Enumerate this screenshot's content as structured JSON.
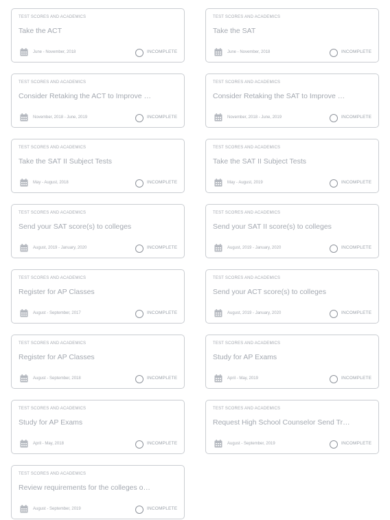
{
  "tasks": [
    {
      "category": "TEST SCORES AND ACADEMICS",
      "title": "Take the ACT",
      "date": "June - November, 2018",
      "status": "INCOMPLETE"
    },
    {
      "category": "TEST SCORES AND ACADEMICS",
      "title": "Take the SAT",
      "date": "June - November, 2018",
      "status": "INCOMPLETE"
    },
    {
      "category": "TEST SCORES AND ACADEMICS",
      "title": "Consider Retaking the ACT to Improve …",
      "date": "November, 2018 - June, 2019",
      "status": "INCOMPLETE"
    },
    {
      "category": "TEST SCORES AND ACADEMICS",
      "title": "Consider Retaking the SAT to Improve …",
      "date": "November, 2018 - June, 2019",
      "status": "INCOMPLETE"
    },
    {
      "category": "TEST SCORES AND ACADEMICS",
      "title": "Take the SAT II Subject Tests",
      "date": "May - August, 2018",
      "status": "INCOMPLETE"
    },
    {
      "category": "TEST SCORES AND ACADEMICS",
      "title": "Take the SAT II Subject Tests",
      "date": "May - August, 2019",
      "status": "INCOMPLETE"
    },
    {
      "category": "TEST SCORES AND ACADEMICS",
      "title": "Send your SAT score(s) to colleges",
      "date": "August, 2019 - January, 2020",
      "status": "INCOMPLETE"
    },
    {
      "category": "TEST SCORES AND ACADEMICS",
      "title": "Send your SAT II score(s) to colleges",
      "date": "August, 2019 - January, 2020",
      "status": "INCOMPLETE"
    },
    {
      "category": "TEST SCORES AND ACADEMICS",
      "title": "Register for AP Classes",
      "date": "August - September, 2017",
      "status": "INCOMPLETE"
    },
    {
      "category": "TEST SCORES AND ACADEMICS",
      "title": "Send your ACT score(s) to colleges",
      "date": "August, 2019 - January, 2020",
      "status": "INCOMPLETE"
    },
    {
      "category": "TEST SCORES AND ACADEMICS",
      "title": "Register for AP Classes",
      "date": "August - September, 2018",
      "status": "INCOMPLETE"
    },
    {
      "category": "TEST SCORES AND ACADEMICS",
      "title": "Study for AP Exams",
      "date": "April - May, 2019",
      "status": "INCOMPLETE"
    },
    {
      "category": "TEST SCORES AND ACADEMICS",
      "title": "Study for AP Exams",
      "date": "April - May, 2018",
      "status": "INCOMPLETE"
    },
    {
      "category": "TEST SCORES AND ACADEMICS",
      "title": "Request High School Counselor Send Tr…",
      "date": "August - September, 2019",
      "status": "INCOMPLETE"
    },
    {
      "category": "TEST SCORES AND ACADEMICS",
      "title": "Review requirements for the colleges o…",
      "date": "August - September, 2019",
      "status": "INCOMPLETE"
    }
  ],
  "colors": {
    "card_border": "#c9ccd1",
    "text_muted": "#a5a9b0",
    "title_text": "#a3a8b0",
    "calendar_icon": "#b4b8bf"
  },
  "icons": {
    "date": "calendar-icon",
    "status": "status-circle-icon"
  }
}
